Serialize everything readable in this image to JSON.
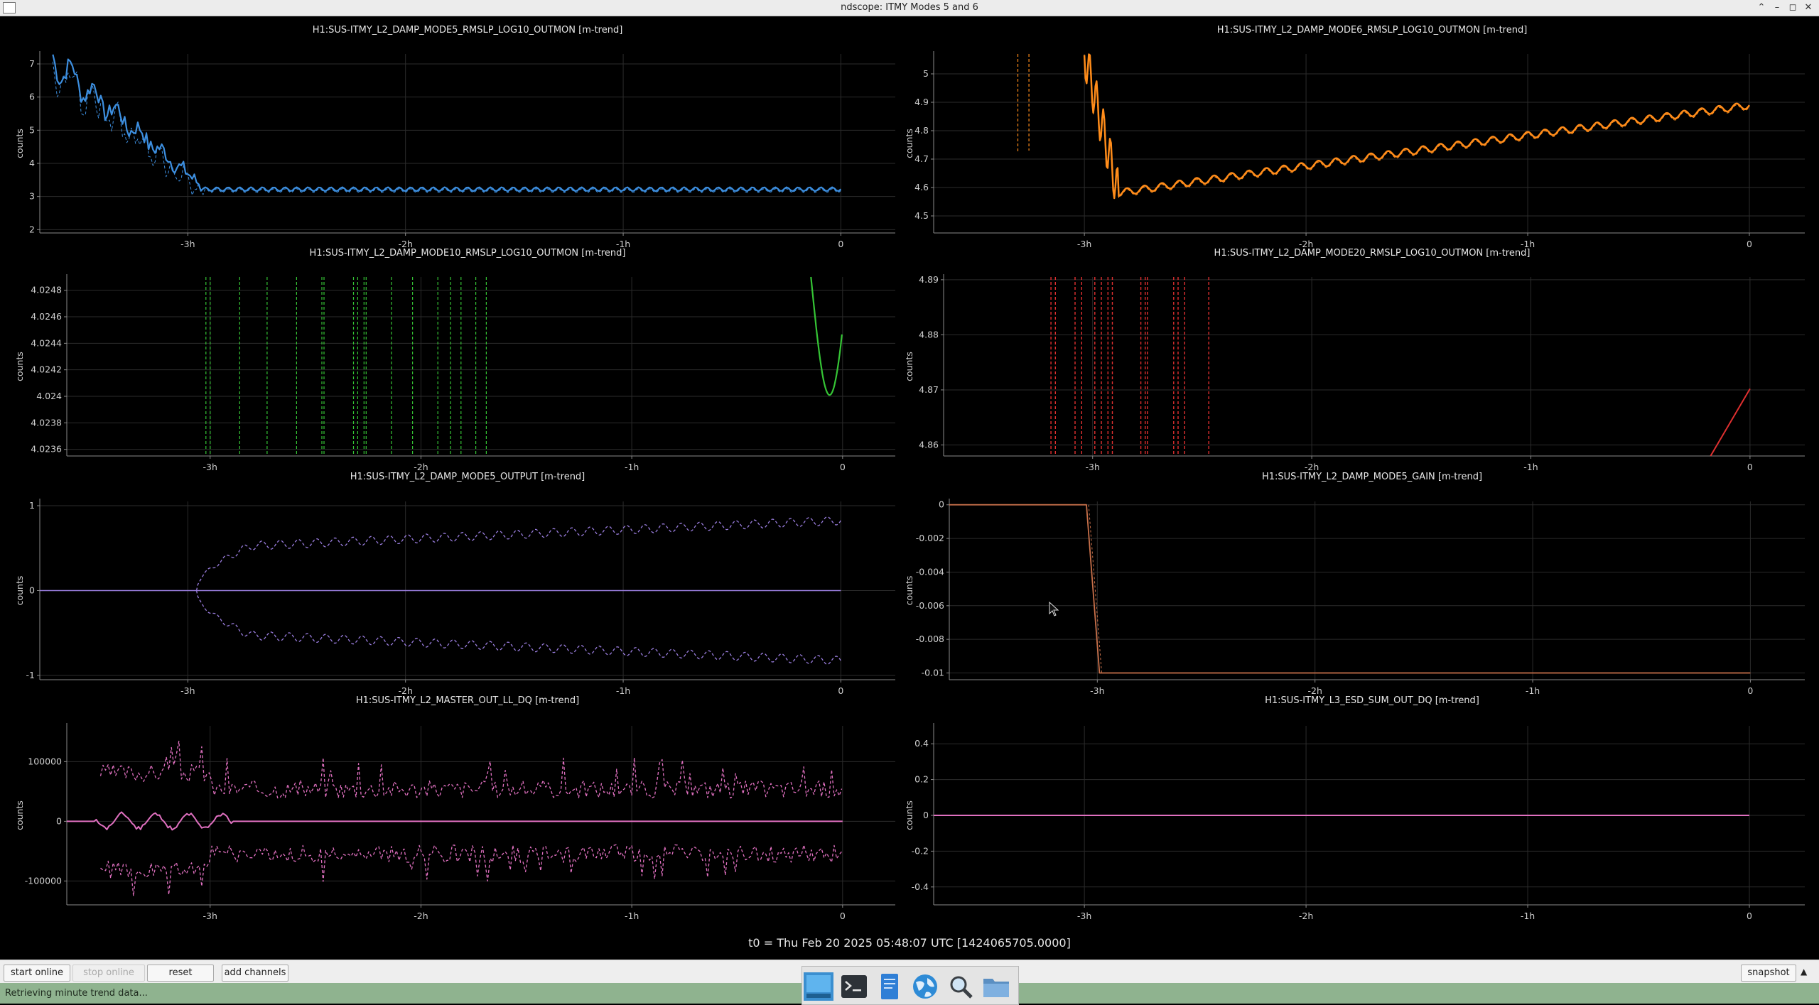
{
  "window": {
    "title": "ndscope: ITMY Modes 5 and 6"
  },
  "plots": [
    {
      "title": "H1:SUS-ITMY_L2_DAMP_MODE5_RMSLP_LOG10_OUTMON [m-trend]",
      "ylabel": "counts",
      "yticks": [
        "2",
        "3",
        "4",
        "5",
        "6",
        "7"
      ],
      "xticks": [
        "-3h",
        "-2h",
        "-1h",
        "0"
      ],
      "color": "#3d8fe0"
    },
    {
      "title": "H1:SUS-ITMY_L2_DAMP_MODE6_RMSLP_LOG10_OUTMON [m-trend]",
      "ylabel": "counts",
      "yticks": [
        "4.5",
        "4.6",
        "4.7",
        "4.8",
        "4.9",
        "5"
      ],
      "xticks": [
        "-3h",
        "-2h",
        "-1h",
        "0"
      ],
      "color": "#ff8c1a"
    },
    {
      "title": "H1:SUS-ITMY_L2_DAMP_MODE10_RMSLP_LOG10_OUTMON [m-trend]",
      "ylabel": "counts",
      "yticks": [
        "4.0236",
        "4.0238",
        "4.024",
        "4.0242",
        "4.0244",
        "4.0246",
        "4.0248"
      ],
      "xticks": [
        "-3h",
        "-2h",
        "-1h",
        "0"
      ],
      "color": "#35c435"
    },
    {
      "title": "H1:SUS-ITMY_L2_DAMP_MODE20_RMSLP_LOG10_OUTMON [m-trend]",
      "ylabel": "counts",
      "yticks": [
        "4.86",
        "4.87",
        "4.88",
        "4.89"
      ],
      "xticks": [
        "-3h",
        "-2h",
        "-1h",
        "0"
      ],
      "color": "#e03030"
    },
    {
      "title": "H1:SUS-ITMY_L2_DAMP_MODE5_OUTPUT [m-trend]",
      "ylabel": "counts",
      "yticks": [
        "-1",
        "0",
        "1"
      ],
      "xticks": [
        "-3h",
        "-2h",
        "-1h",
        "0"
      ],
      "color": "#9b7ee0"
    },
    {
      "title": "H1:SUS-ITMY_L2_DAMP_MODE5_GAIN [m-trend]",
      "ylabel": "counts",
      "yticks": [
        "-0.01",
        "-0.008",
        "-0.006",
        "-0.004",
        "-0.002",
        "0"
      ],
      "xticks": [
        "-3h",
        "-2h",
        "-1h",
        "0"
      ],
      "color": "#c8704a"
    },
    {
      "title": "H1:SUS-ITMY_L2_MASTER_OUT_LL_DQ [m-trend]",
      "ylabel": "counts",
      "yticks": [
        "-100000",
        "0",
        "100000"
      ],
      "xticks": [
        "-3h",
        "-2h",
        "-1h",
        "0"
      ],
      "color": "#e070c0"
    },
    {
      "title": "H1:SUS-ITMY_L3_ESD_SUM_OUT_DQ [m-trend]",
      "ylabel": "counts",
      "yticks": [
        "-0.4",
        "-0.2",
        "0",
        "0.2",
        "0.4"
      ],
      "xticks": [
        "-3h",
        "-2h",
        "-1h",
        "0"
      ],
      "color": "#e070c0"
    }
  ],
  "chart_data": [
    {
      "type": "line",
      "title": "H1:SUS-ITMY_L2_DAMP_MODE5_RMSLP_LOG10_OUTMON [m-trend]",
      "ylabel": "counts",
      "xlabel": "",
      "x_unit": "hours",
      "xlim": [
        -3.68,
        0.25
      ],
      "ylim": [
        1.9,
        7.3
      ],
      "series": [
        {
          "x": [
            -3.6,
            -3.5,
            -3.4,
            -3.3,
            -3.2,
            -3.0,
            -2.0,
            -1.0,
            0
          ],
          "y": [
            7.1,
            5.6,
            5.4,
            6.3,
            4.8,
            3.2,
            3.2,
            3.2,
            3.25
          ]
        }
      ]
    },
    {
      "type": "line",
      "title": "H1:SUS-ITMY_L2_DAMP_MODE6_RMSLP_LOG10_OUTMON [m-trend]",
      "ylabel": "counts",
      "xlabel": "",
      "x_unit": "hours",
      "xlim": [
        -3.68,
        0.25
      ],
      "ylim": [
        4.44,
        5.07
      ],
      "series": [
        {
          "x": [
            -3.0,
            -2.8,
            -2.4,
            -2.0,
            -1.6,
            -1.2,
            -0.8,
            -0.4,
            0
          ],
          "y": [
            4.58,
            4.62,
            4.67,
            4.72,
            4.76,
            4.8,
            4.83,
            4.86,
            4.89
          ]
        }
      ]
    },
    {
      "type": "line",
      "title": "H1:SUS-ITMY_L2_DAMP_MODE10_RMSLP_LOG10_OUTMON [m-trend]",
      "ylabel": "counts",
      "xlabel": "",
      "x_unit": "hours",
      "xlim": [
        -3.68,
        0.25
      ],
      "ylim": [
        4.02355,
        4.0249
      ],
      "series": [
        {
          "x": [
            -0.15,
            -0.1,
            -0.05,
            0
          ],
          "y": [
            4.0249,
            4.0243,
            4.024,
            4.0241
          ]
        }
      ]
    },
    {
      "type": "line",
      "title": "H1:SUS-ITMY_L2_DAMP_MODE20_RMSLP_LOG10_OUTMON [m-trend]",
      "ylabel": "counts",
      "xlabel": "",
      "x_unit": "hours",
      "xlim": [
        -3.68,
        0.25
      ],
      "ylim": [
        4.858,
        4.8905
      ],
      "series": [
        {
          "x": [
            -0.2,
            -0.1,
            0
          ],
          "y": [
            4.858,
            4.864,
            4.87
          ]
        }
      ]
    },
    {
      "type": "line",
      "title": "H1:SUS-ITMY_L2_DAMP_MODE5_OUTPUT [m-trend]",
      "ylabel": "counts",
      "xlabel": "",
      "x_unit": "hours",
      "xlim": [
        -3.68,
        0.25
      ],
      "ylim": [
        -1.05,
        1.05
      ],
      "series": [
        {
          "name": "mean",
          "x": [
            -3.68,
            0
          ],
          "y": [
            0,
            0
          ]
        },
        {
          "name": "max",
          "x": [
            -2.95,
            -2.5,
            -2.0,
            -1.0,
            0
          ],
          "y": [
            0,
            0.55,
            0.6,
            0.75,
            0.9
          ]
        },
        {
          "name": "min",
          "x": [
            -2.95,
            -2.5,
            -2.0,
            -1.0,
            0
          ],
          "y": [
            0,
            -0.55,
            -0.6,
            -0.75,
            -0.9
          ]
        }
      ]
    },
    {
      "type": "line",
      "title": "H1:SUS-ITMY_L2_DAMP_MODE5_GAIN [m-trend]",
      "ylabel": "counts",
      "xlabel": "",
      "x_unit": "hours",
      "xlim": [
        -3.68,
        0.25
      ],
      "ylim": [
        -0.0104,
        0.0002
      ],
      "series": [
        {
          "x": [
            -3.68,
            -3.05,
            -2.98,
            0
          ],
          "y": [
            0,
            0,
            -0.01,
            -0.01
          ]
        }
      ]
    },
    {
      "type": "line",
      "title": "H1:SUS-ITMY_L2_MASTER_OUT_LL_DQ [m-trend]",
      "ylabel": "counts",
      "xlabel": "",
      "x_unit": "hours",
      "xlim": [
        -3.68,
        0.25
      ],
      "ylim": [
        -140000,
        160000
      ],
      "series": [
        {
          "name": "mean",
          "x": [
            -3.68,
            0
          ],
          "y": [
            0,
            0
          ]
        },
        {
          "name": "max",
          "x": [
            -3.5,
            -3.0,
            -2.0,
            -1.0,
            0
          ],
          "y": [
            90000,
            150000,
            55000,
            55000,
            50000
          ]
        },
        {
          "name": "min",
          "x": [
            -3.5,
            -3.0,
            -2.0,
            -1.0,
            0
          ],
          "y": [
            -90000,
            -120000,
            -50000,
            -50000,
            -45000
          ]
        }
      ]
    },
    {
      "type": "line",
      "title": "H1:SUS-ITMY_L3_ESD_SUM_OUT_DQ [m-trend]",
      "ylabel": "counts",
      "xlabel": "",
      "x_unit": "hours",
      "xlim": [
        -3.68,
        0.25
      ],
      "ylim": [
        -0.5,
        0.5
      ],
      "series": [
        {
          "x": [
            -3.68,
            0
          ],
          "y": [
            0,
            0
          ]
        }
      ]
    }
  ],
  "t0_label": "t0 = Thu Feb 20 2025 05:48:07 UTC [1424065705.0000]",
  "toolbar": {
    "start_online": "start online",
    "stop_online": "stop online",
    "reset": "reset",
    "add_channels": "add channels",
    "snapshot": "snapshot"
  },
  "status": {
    "text": "Retrieving minute trend data..."
  },
  "taskbar": {
    "icons": [
      "desktop-icon",
      "terminal-icon",
      "text-editor-icon",
      "browser-globe-icon",
      "magnifier-icon",
      "file-manager-icon"
    ]
  },
  "colors": {
    "statusbar": "#8fb38f",
    "background": "#000000"
  }
}
